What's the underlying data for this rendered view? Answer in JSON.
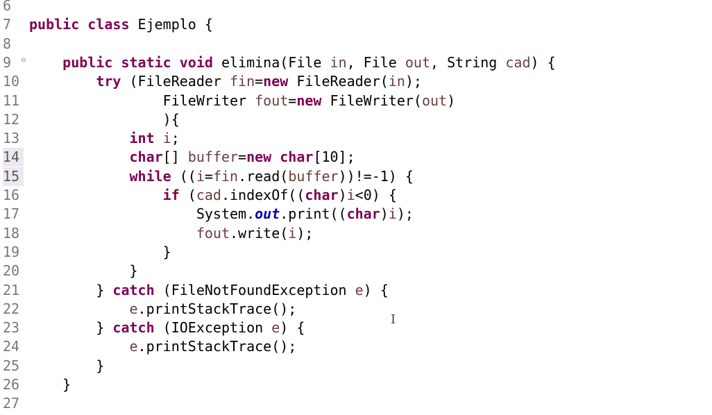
{
  "editor": {
    "lines": [
      {
        "no": "6",
        "tokens": []
      },
      {
        "no": "7",
        "tokens": [
          {
            "t": "public class",
            "c": "kw"
          },
          {
            "t": " Ejemplo {",
            "c": ""
          }
        ]
      },
      {
        "no": "8",
        "tokens": []
      },
      {
        "no": "9",
        "fold": "⊖",
        "tokens": [
          {
            "t": "    ",
            "c": ""
          },
          {
            "t": "public static void",
            "c": "kw"
          },
          {
            "t": " elimina(File ",
            "c": ""
          },
          {
            "t": "in",
            "c": "var"
          },
          {
            "t": ", File ",
            "c": ""
          },
          {
            "t": "out",
            "c": "var"
          },
          {
            "t": ", String ",
            "c": ""
          },
          {
            "t": "cad",
            "c": "var"
          },
          {
            "t": ") {",
            "c": ""
          }
        ]
      },
      {
        "no": "10",
        "tokens": [
          {
            "t": "        ",
            "c": ""
          },
          {
            "t": "try",
            "c": "kw"
          },
          {
            "t": " (FileReader ",
            "c": ""
          },
          {
            "t": "fin",
            "c": "var"
          },
          {
            "t": "=",
            "c": ""
          },
          {
            "t": "new",
            "c": "kw"
          },
          {
            "t": " FileReader(",
            "c": ""
          },
          {
            "t": "in",
            "c": "var"
          },
          {
            "t": ");",
            "c": ""
          }
        ]
      },
      {
        "no": "11",
        "tokens": [
          {
            "t": "                FileWriter ",
            "c": ""
          },
          {
            "t": "fout",
            "c": "var"
          },
          {
            "t": "=",
            "c": ""
          },
          {
            "t": "new",
            "c": "kw"
          },
          {
            "t": " FileWriter(",
            "c": ""
          },
          {
            "t": "out",
            "c": "var"
          },
          {
            "t": ")",
            "c": ""
          }
        ]
      },
      {
        "no": "12",
        "tokens": [
          {
            "t": "                ){",
            "c": ""
          }
        ]
      },
      {
        "no": "13",
        "tokens": [
          {
            "t": "            ",
            "c": ""
          },
          {
            "t": "int",
            "c": "kw"
          },
          {
            "t": " ",
            "c": ""
          },
          {
            "t": "i",
            "c": "var"
          },
          {
            "t": ";",
            "c": ""
          }
        ]
      },
      {
        "no": "14",
        "hl": true,
        "tokens": [
          {
            "t": "            ",
            "c": ""
          },
          {
            "t": "char",
            "c": "kw"
          },
          {
            "t": "[] ",
            "c": ""
          },
          {
            "t": "buffer",
            "c": "var"
          },
          {
            "t": "=",
            "c": ""
          },
          {
            "t": "new",
            "c": "kw"
          },
          {
            "t": " ",
            "c": ""
          },
          {
            "t": "char",
            "c": "kw"
          },
          {
            "t": "[10];",
            "c": ""
          }
        ]
      },
      {
        "no": "15",
        "hl": true,
        "tokens": [
          {
            "t": "            ",
            "c": ""
          },
          {
            "t": "while",
            "c": "kw"
          },
          {
            "t": " ((",
            "c": ""
          },
          {
            "t": "i",
            "c": "var"
          },
          {
            "t": "=",
            "c": ""
          },
          {
            "t": "fin",
            "c": "var"
          },
          {
            "t": ".read(",
            "c": ""
          },
          {
            "t": "buffer",
            "c": "var"
          },
          {
            "t": "))!=-1) {",
            "c": ""
          }
        ]
      },
      {
        "no": "16",
        "tokens": [
          {
            "t": "                ",
            "c": ""
          },
          {
            "t": "if",
            "c": "kw"
          },
          {
            "t": " (",
            "c": ""
          },
          {
            "t": "cad",
            "c": "var"
          },
          {
            "t": ".indexOf((",
            "c": ""
          },
          {
            "t": "char",
            "c": "kw"
          },
          {
            "t": ")",
            "c": ""
          },
          {
            "t": "i",
            "c": "var"
          },
          {
            "t": "<0) {",
            "c": ""
          }
        ]
      },
      {
        "no": "17",
        "tokens": [
          {
            "t": "                    System.",
            "c": ""
          },
          {
            "t": "out",
            "c": "fld"
          },
          {
            "t": ".print((",
            "c": ""
          },
          {
            "t": "char",
            "c": "kw"
          },
          {
            "t": ")",
            "c": ""
          },
          {
            "t": "i",
            "c": "var"
          },
          {
            "t": ");",
            "c": ""
          }
        ]
      },
      {
        "no": "18",
        "tokens": [
          {
            "t": "                    ",
            "c": ""
          },
          {
            "t": "fout",
            "c": "var"
          },
          {
            "t": ".write(",
            "c": ""
          },
          {
            "t": "i",
            "c": "var"
          },
          {
            "t": ");",
            "c": ""
          }
        ]
      },
      {
        "no": "19",
        "tokens": [
          {
            "t": "                }",
            "c": ""
          }
        ]
      },
      {
        "no": "20",
        "tokens": [
          {
            "t": "            }",
            "c": ""
          }
        ]
      },
      {
        "no": "21",
        "tokens": [
          {
            "t": "        } ",
            "c": ""
          },
          {
            "t": "catch",
            "c": "kw"
          },
          {
            "t": " (FileNotFoundException ",
            "c": ""
          },
          {
            "t": "e",
            "c": "var"
          },
          {
            "t": ") {",
            "c": ""
          }
        ]
      },
      {
        "no": "22",
        "tokens": [
          {
            "t": "            ",
            "c": ""
          },
          {
            "t": "e",
            "c": "var"
          },
          {
            "t": ".printStackTrace();",
            "c": ""
          }
        ]
      },
      {
        "no": "23",
        "tokens": [
          {
            "t": "        } ",
            "c": ""
          },
          {
            "t": "catch",
            "c": "kw"
          },
          {
            "t": " (IOException ",
            "c": ""
          },
          {
            "t": "e",
            "c": "var"
          },
          {
            "t": ") {",
            "c": ""
          }
        ]
      },
      {
        "no": "24",
        "tokens": [
          {
            "t": "            ",
            "c": ""
          },
          {
            "t": "e",
            "c": "var"
          },
          {
            "t": ".printStackTrace();",
            "c": ""
          }
        ]
      },
      {
        "no": "25",
        "tokens": [
          {
            "t": "        }",
            "c": ""
          }
        ]
      },
      {
        "no": "26",
        "tokens": [
          {
            "t": "    }",
            "c": ""
          }
        ]
      },
      {
        "no": "27",
        "tokens": []
      }
    ],
    "cursor_glyph": "I"
  },
  "colors": {
    "keyword": "#7f0055",
    "variable": "#6a3e3e",
    "static_field": "#0000c0",
    "line_number": "#787878",
    "line_highlight": "#ece7f1"
  }
}
